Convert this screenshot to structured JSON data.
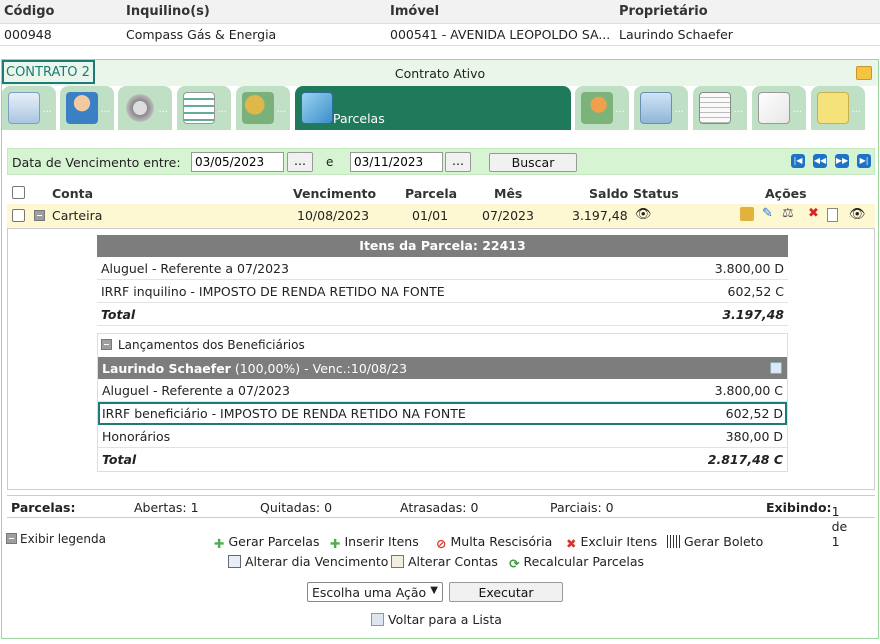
{
  "header": {
    "cols": [
      "Código",
      "Inquilino(s)",
      "Imóvel",
      "Proprietário"
    ],
    "values": [
      "000948",
      "Compass Gás & Energia",
      "000541 - AVENIDA LEOPOLDO SA...",
      "Laurindo Schaefer"
    ]
  },
  "contract": {
    "name": "CONTRATO 2",
    "status": "Contrato Ativo"
  },
  "tabs": {
    "dots": "...",
    "active_label": "Parcelas"
  },
  "search": {
    "label": "Data de Vencimento entre:",
    "date_from": "03/05/2023",
    "date_to": "03/11/2023",
    "picker": "...",
    "sep": "e",
    "button": "Buscar"
  },
  "grid": {
    "headers": {
      "conta": "Conta",
      "vencimento": "Vencimento",
      "parcela": "Parcela",
      "mes": "Mês",
      "saldo": "Saldo",
      "status": "Status",
      "acoes": "Ações"
    },
    "row": {
      "conta": "Carteira",
      "vencimento": "10/08/2023",
      "parcela": "01/01",
      "mes": "07/2023",
      "saldo": "3.197,48"
    }
  },
  "itens": {
    "title": "Itens da Parcela: 22413",
    "rows": [
      {
        "desc": "Aluguel - Referente a 07/2023",
        "val": "3.800,00 D"
      },
      {
        "desc": "IRRF inquilino - IMPOSTO DE RENDA RETIDO NA FONTE",
        "val": "602,52 C"
      }
    ],
    "total_label": "Total",
    "total_val": "3.197,48"
  },
  "beneficiarios": {
    "title": "Lançamentos dos Beneficiários",
    "owner": "Laurindo Schaefer",
    "owner_info": " (100,00%) - Venc.:10/08/23",
    "rows": [
      {
        "desc": "Aluguel - Referente a 07/2023",
        "val": "3.800,00 C"
      },
      {
        "desc": "IRRF beneficiário - IMPOSTO DE RENDA RETIDO NA FONTE",
        "val": "602,52 D"
      },
      {
        "desc": "Honorários",
        "val": "380,00 D"
      }
    ],
    "total_label": "Total",
    "total_val": "2.817,48 C"
  },
  "summary": {
    "parcelas": "Parcelas:",
    "abertas": "Abertas: 1",
    "quitadas": "Quitadas: 0",
    "atrasadas": "Atrasadas: 0",
    "parciais": "Parciais: 0",
    "exibindo": "Exibindo:",
    "exibindo_val": " 1 de 1"
  },
  "actions": {
    "legend": "Exibir legenda",
    "gerar_parcelas": "Gerar Parcelas",
    "inserir_itens": "Inserir Itens",
    "multa": "Multa Rescisória",
    "excluir_itens": "Excluir Itens",
    "gerar_boleto": "Gerar Boleto",
    "alterar_dia": "Alterar dia Vencimento",
    "alterar_contas": "Alterar Contas",
    "recalcular": "Recalcular Parcelas",
    "select_value": "Escolha uma Ação",
    "executar": "Executar",
    "voltar": "Voltar para a Lista"
  }
}
